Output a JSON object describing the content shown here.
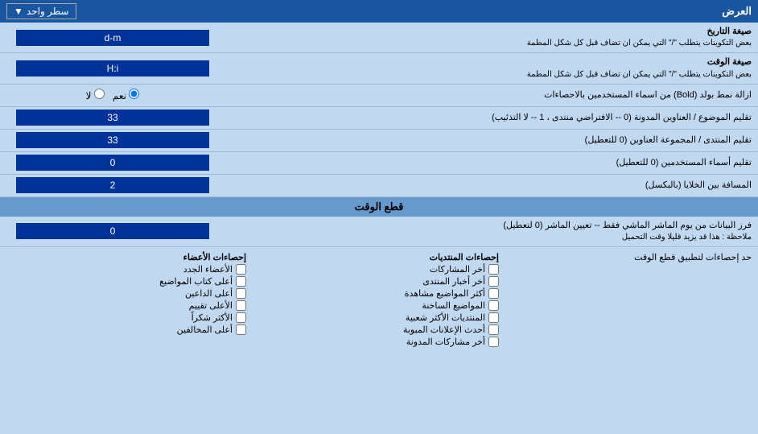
{
  "header": {
    "title": "العرض",
    "dropdown_label": "سطر واحد",
    "dropdown_icon": "▼"
  },
  "rows": [
    {
      "id": "date_format",
      "label": "صيغة التاريخ",
      "sublabel": "بعض التكوينات يتطلب \"/\" التي يمكن ان تضاف قبل كل شكل المطمة",
      "value": "d-m",
      "type": "input"
    },
    {
      "id": "time_format",
      "label": "صيغة الوقت",
      "sublabel": "بعض التكوينات يتطلب \"/\" التي يمكن ان تضاف قبل كل شكل المطمة",
      "value": "H:i",
      "type": "input"
    },
    {
      "id": "remove_bold",
      "label": "ازالة نمط بولد (Bold) من اسماء المستخدمين بالاحصاءات",
      "radio_options": [
        {
          "label": "نعم",
          "value": "yes",
          "checked": true
        },
        {
          "label": "لا",
          "value": "no",
          "checked": false
        }
      ],
      "type": "radio"
    },
    {
      "id": "sort_titles",
      "label": "تقليم الموضوع / العناوين المدونة (0 -- الافتراضي منتدى ، 1 -- لا التذئيب)",
      "value": "33",
      "type": "input"
    },
    {
      "id": "sort_forum",
      "label": "تقليم المنتدى / المجموعة العناوين (0 للتعطيل)",
      "value": "33",
      "type": "input"
    },
    {
      "id": "sort_users",
      "label": "تقليم أسماء المستخدمين (0 للتعطيل)",
      "value": "0",
      "type": "input"
    },
    {
      "id": "cell_spacing",
      "label": "المسافة بين الخلايا (بالبكسل)",
      "value": "2",
      "type": "input"
    }
  ],
  "cut_section": {
    "title": "قطع الوقت",
    "row": {
      "label": "فرز البيانات من يوم الماشر الماشي فقط -- تعيين الماشر (0 لتعطيل)",
      "note": "ملاحظة : هذا قد يزيد قليلا وقت التحميل",
      "value": "0"
    }
  },
  "stats_section": {
    "limit_label": "حد إحصاءات لتطبيق قطع الوقت",
    "col1": {
      "header": "إحصاءات المنتديات",
      "items": [
        "أخر المشاركات",
        "أخر أخبار المنتدى",
        "أكثر المواضيع مشاهدة",
        "المواضيع الساخنة",
        "المنتديات الأكثر شعبية",
        "أحدث الإعلانات المبوبة",
        "أخر مشاركات المدونة"
      ]
    },
    "col2": {
      "header": "إحصاءات الأعضاء",
      "items": [
        "الأعضاء الجدد",
        "أعلى كتاب المواضيع",
        "أعلى الداعين",
        "الأعلى تقييم",
        "الأكثر شكراً",
        "أعلى المخالفين"
      ]
    }
  }
}
